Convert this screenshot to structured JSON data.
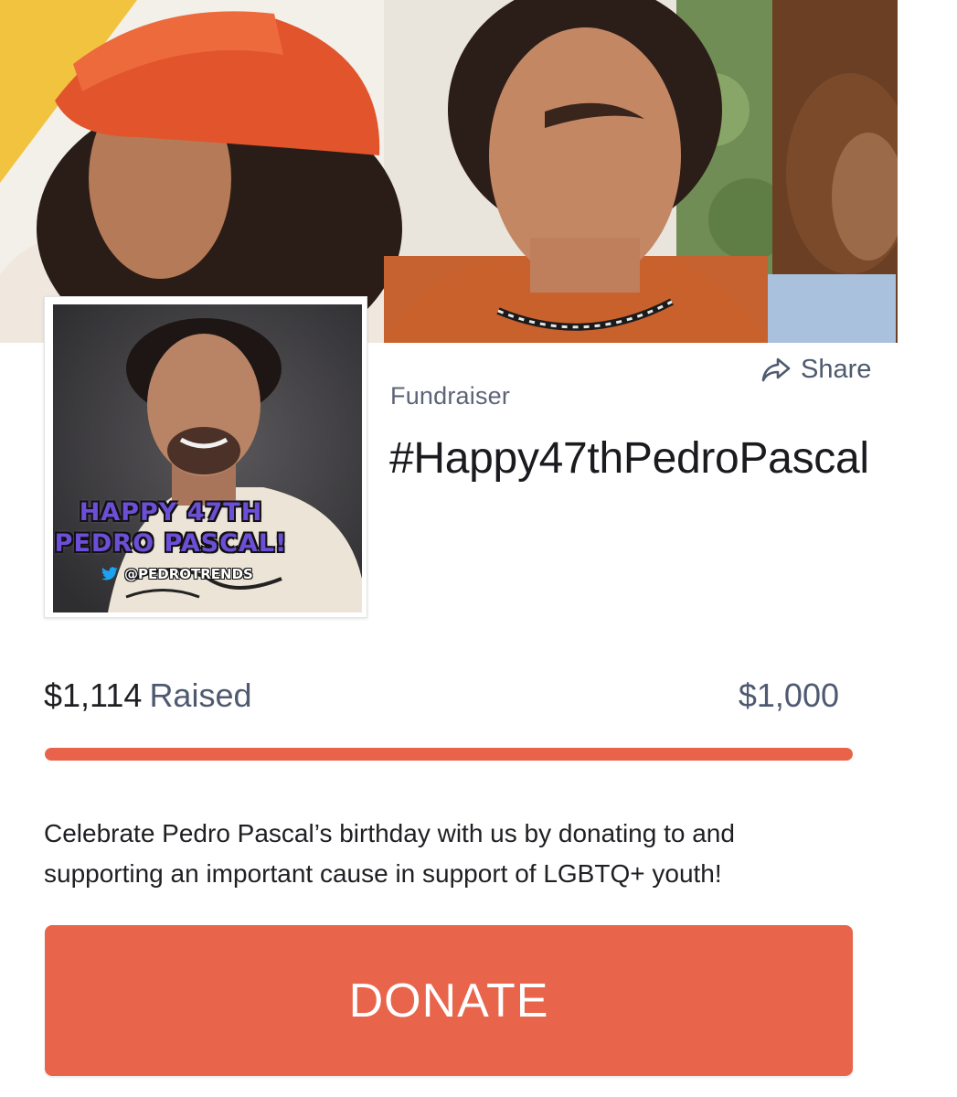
{
  "banner": {
    "image_alt": "Three young people in warm-toned clothing"
  },
  "avatar": {
    "image_alt": "Pedro Pascal portrait",
    "promo_line1": "HAPPY 47TH",
    "promo_line2": "PEDRO PASCAL!",
    "promo_handle": "@PEDROTRENDS"
  },
  "share": {
    "label": "Share",
    "icon": "share-arrow-icon"
  },
  "fundraiser": {
    "eyebrow": "Fundraiser",
    "title": "#Happy47thPedroPascal",
    "raised_amount": "$1,114",
    "raised_label": "Raised",
    "goal_amount": "$1,000",
    "progress_fraction": 1.0,
    "description": "Celebrate Pedro Pascal’s birthday with us by donating to and supporting an important cause in support of LGBTQ+ youth!"
  },
  "donate": {
    "label": "DONATE"
  },
  "colors": {
    "accent": "#e8654b",
    "muted_text": "#4f5a71",
    "banner_yellow": "#f2c543"
  }
}
